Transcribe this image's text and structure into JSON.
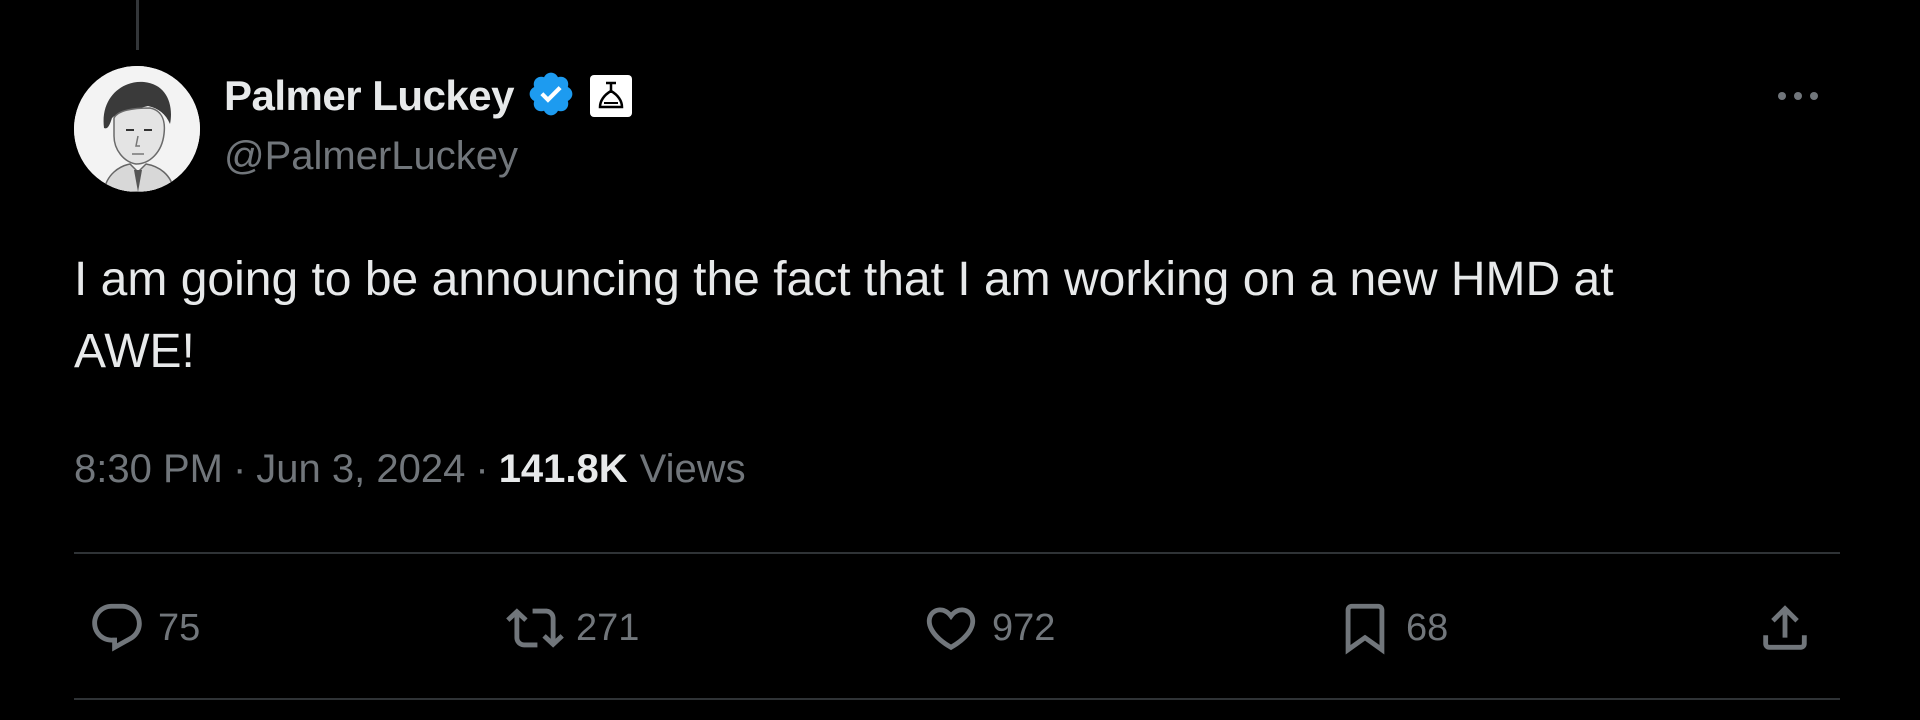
{
  "tweet": {
    "author": {
      "display_name": "Palmer Luckey",
      "handle": "@PalmerLuckey",
      "verified_icon": "verified-badge-icon",
      "affiliation_icon": "affiliation-badge-icon"
    },
    "text": "I am going to be announcing the fact that I am working on a new HMD at\nAWE!",
    "timestamp": {
      "time": "8:30 PM",
      "separator": "·",
      "date": "Jun 3, 2024"
    },
    "views": {
      "count": "141.8K",
      "label": "Views"
    },
    "actions": {
      "reply_count": "75",
      "retweet_count": "271",
      "like_count": "972",
      "bookmark_count": "68"
    }
  },
  "colors": {
    "background": "#000000",
    "primary_text": "#e7e9ea",
    "secondary_text": "#71767b",
    "verified_blue": "#1d9bf0",
    "divider": "#2f3336"
  }
}
